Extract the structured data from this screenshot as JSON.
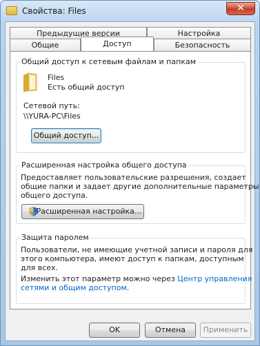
{
  "window": {
    "title": "Свойства: Files",
    "close_symbol": "✕"
  },
  "tabs": {
    "row1": [
      "Предыдущие версии",
      "Настройка"
    ],
    "row2": [
      "Общие",
      "Доступ",
      "Безопасность"
    ],
    "active": "Доступ"
  },
  "network_sharing": {
    "group_title": "Общий доступ к сетевым файлам и папкам",
    "folder_name": "Files",
    "folder_status": "Есть общий доступ",
    "path_label": "Сетевой путь:",
    "path_value": "\\\\YURA-PC\\Files",
    "share_button": "Общий доступ..."
  },
  "advanced_sharing": {
    "group_title": "Расширенная настройка общего доступа",
    "description_line1": "Предоставляет пользовательские разрешения, создает",
    "description_line2": "общие папки и задает другие дополнительные параметры",
    "description_line3": "общего доступа.",
    "button": "Расширенная настройка..."
  },
  "password_protection": {
    "group_title": "Защита паролем",
    "line1": "Пользователи, не имеющие учетной записи и пароля для",
    "line2": "этого компьютера, имеют доступ к папкам, доступным",
    "line3": "для всех.",
    "change_prefix": "Изменить этот параметр можно через ",
    "link_part1": "Центр управления",
    "link_part2": "сетями и общим доступом",
    "period": "."
  },
  "footer": {
    "ok": "OK",
    "cancel": "Отмена",
    "apply": "Применить"
  }
}
